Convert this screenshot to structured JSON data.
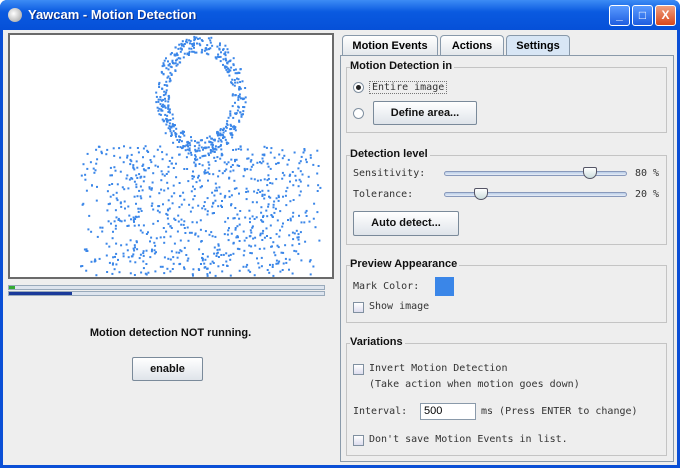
{
  "window": {
    "title": "Yawcam - Motion Detection",
    "minimize": "_",
    "maximize": "□",
    "close": "X"
  },
  "preview": {
    "mark_color": "#3a86e8",
    "progress_green": 0.02,
    "progress_blue": 0.2
  },
  "status": "Motion detection NOT running.",
  "enable_label": "enable",
  "tabs": [
    {
      "label": "Motion Events"
    },
    {
      "label": "Actions"
    },
    {
      "label": "Settings"
    }
  ],
  "settings": {
    "motion_detection_in": {
      "title": "Motion Detection in",
      "entire_image": "Entire image",
      "define_area": "Define area..."
    },
    "detection_level": {
      "title": "Detection level",
      "sensitivity_label": "Sensitivity:",
      "sensitivity_value": 80,
      "sensitivity_text": "80 %",
      "tolerance_label": "Tolerance:",
      "tolerance_value": 20,
      "tolerance_text": "20 %",
      "auto_detect": "Auto detect..."
    },
    "preview_appearance": {
      "title": "Preview Appearance",
      "mark_color_label": "Mark Color:",
      "mark_color": "#3a86e8",
      "show_image": "Show image"
    },
    "variations": {
      "title": "Variations",
      "invert": "Invert Motion Detection",
      "invert_note": "(Take action when motion goes down)",
      "interval_label": "Interval:",
      "interval_value": "500",
      "interval_note": "ms (Press ENTER to change)",
      "dont_save": "Don't save Motion Events in list."
    }
  }
}
